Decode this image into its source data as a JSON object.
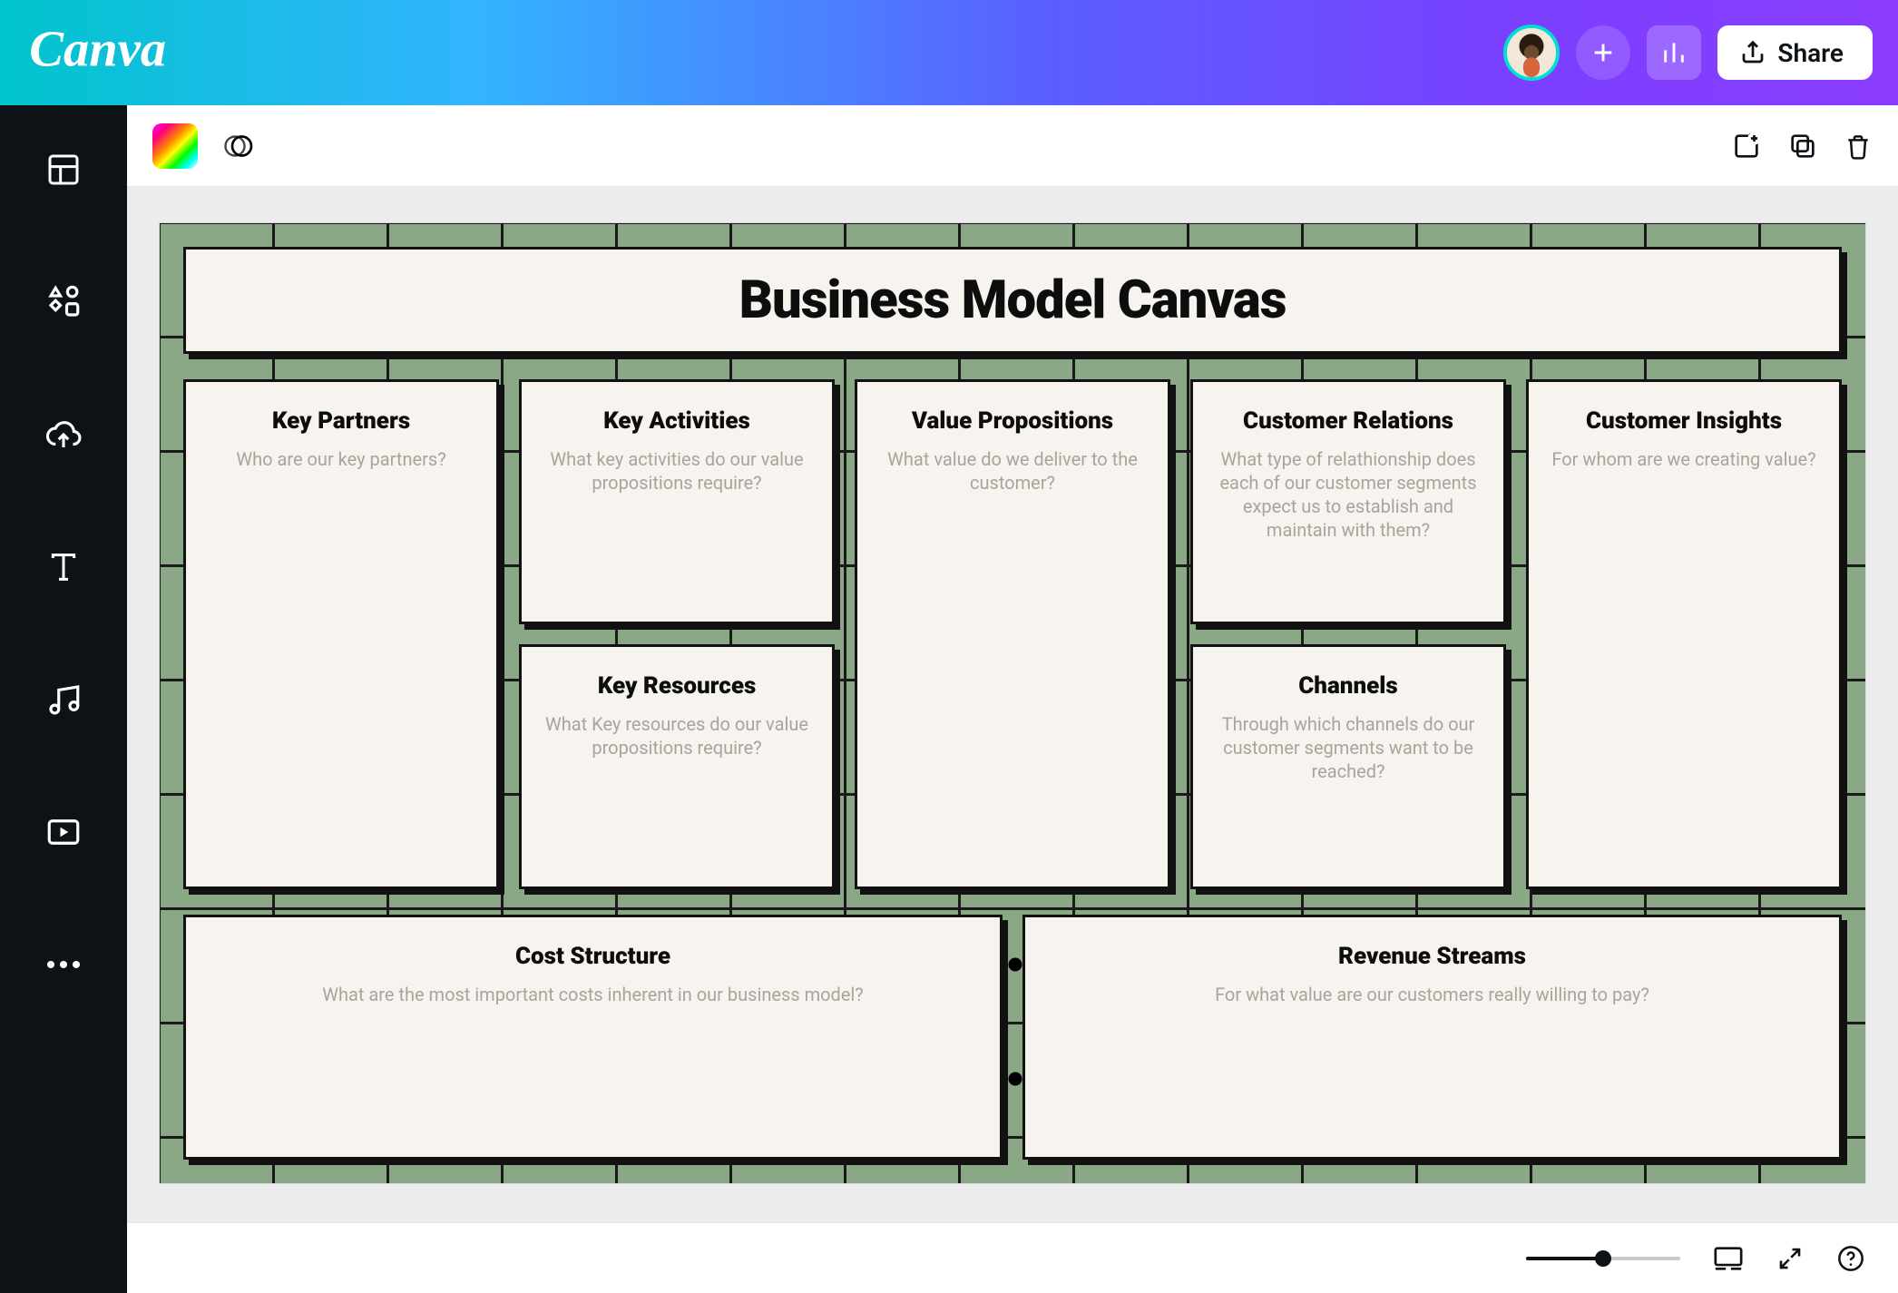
{
  "header": {
    "share_label": "Share"
  },
  "canvas": {
    "title": "Business Model Canvas",
    "cards": {
      "key_partners": {
        "title": "Key Partners",
        "prompt": "Who are our key partners?"
      },
      "key_activities": {
        "title": "Key Activities",
        "prompt": "What key activities do our value propositions require?"
      },
      "key_resources": {
        "title": "Key Resources",
        "prompt": "What Key resources do our value propositions require?"
      },
      "value_prop": {
        "title": "Value Propositions",
        "prompt": "What value do we deliver to the customer?"
      },
      "cust_relations": {
        "title": "Customer Relations",
        "prompt": "What type of relathionship does each of our customer segments expect us to establish and maintain with them?"
      },
      "channels": {
        "title": "Channels",
        "prompt": "Through which channels do our customer segments want to be reached?"
      },
      "cust_insights": {
        "title": "Customer Insights",
        "prompt": "For whom are we creating value?"
      },
      "cost_structure": {
        "title": "Cost Structure",
        "prompt": "What are the most important costs inherent in our business model?"
      },
      "revenue": {
        "title": "Revenue Streams",
        "prompt": "For what value are our customers really willing to pay?"
      }
    }
  }
}
